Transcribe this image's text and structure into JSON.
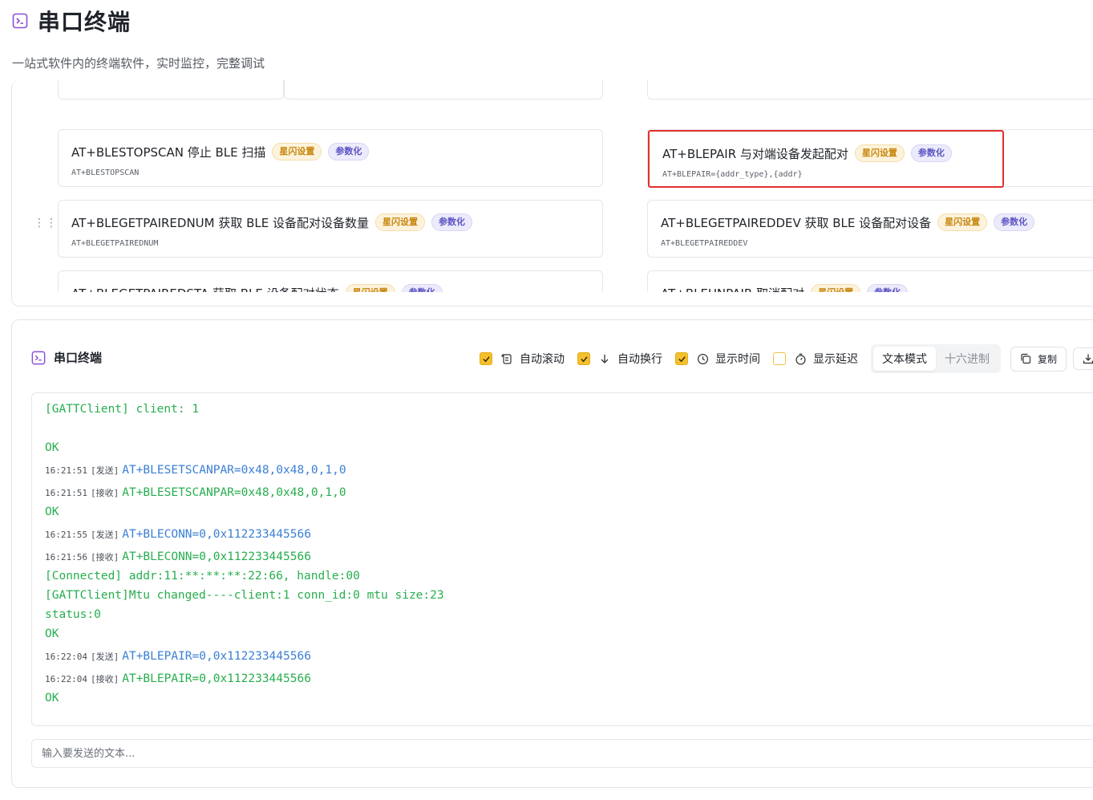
{
  "header": {
    "title": "串口终端",
    "subtitle": "一站式软件内的终端软件，实时监控，完整调试"
  },
  "commands": {
    "left": [
      {
        "title": "AT+BLESTOPSCAN 停止 BLE 扫描",
        "cmd": "AT+BLESTOPSCAN"
      },
      {
        "title": "AT+BLEGETPAIREDNUM 获取 BLE 设备配对设备数量",
        "cmd": "AT+BLEGETPAIREDNUM"
      },
      {
        "title": "AT+BLEGETPAIREDSTA 获取 BLE 设备配对状态",
        "cmd": ""
      }
    ],
    "right": [
      {
        "title": "AT+BLEPAIR 与对端设备发起配对",
        "cmd": "AT+BLEPAIR={addr_type},{addr}"
      },
      {
        "title": "AT+BLEGETPAIREDDEV 获取 BLE 设备配对设备",
        "cmd": "AT+BLEGETPAIREDDEV"
      },
      {
        "title": "AT+BLEUNPAIR 取消配对",
        "cmd": ""
      }
    ],
    "tag_flash": "星闪设置",
    "tag_param": "参数化"
  },
  "terminal": {
    "title": "串口终端",
    "options": {
      "auto_scroll": "自动滚动",
      "auto_wrap": "自动换行",
      "show_time": "显示时间",
      "show_delay": "显示延迟"
    },
    "mode_text": "文本模式",
    "mode_hex": "十六进制",
    "copy": "复制",
    "input_placeholder": "输入要发送的文本...",
    "lines": [
      {
        "text": "[GATTClient] client: 1"
      },
      {
        "text": "OK"
      },
      {
        "ts": "16:21:51",
        "dir": "[发送]",
        "text": "AT+BLESETSCANPAR=0x48,0x48,0,1,0"
      },
      {
        "ts": "16:21:51",
        "dir": "[接收]",
        "text": "AT+BLESETSCANPAR=0x48,0x48,0,1,0"
      },
      {
        "text": "OK"
      },
      {
        "ts": "16:21:55",
        "dir": "[发送]",
        "text": "AT+BLECONN=0,0x112233445566"
      },
      {
        "ts": "16:21:56",
        "dir": "[接收]",
        "text": "AT+BLECONN=0,0x112233445566"
      },
      {
        "text": "[Connected] addr:11:**:**:**:22:66, handle:00"
      },
      {
        "text": "[GATTClient]Mtu changed----client:1 conn_id:0 mtu size:23"
      },
      {
        "text": "status:0"
      },
      {
        "text": "OK"
      },
      {
        "ts": "16:22:04",
        "dir": "[发送]",
        "text": "AT+BLEPAIR=0,0x112233445566"
      },
      {
        "ts": "16:22:04",
        "dir": "[接收]",
        "text": "AT+BLEPAIR=0,0x112233445566"
      },
      {
        "text": "OK"
      }
    ]
  }
}
